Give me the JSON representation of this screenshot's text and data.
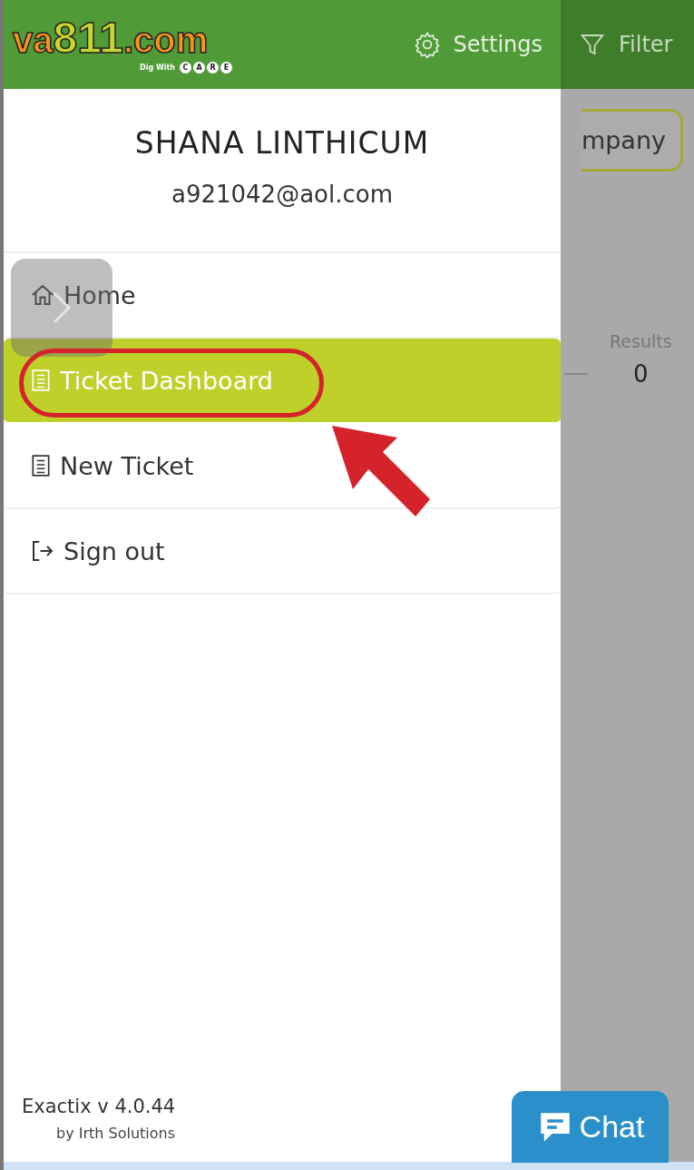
{
  "header": {
    "logo": {
      "parts": [
        "va",
        "811",
        ".com"
      ],
      "tagline": "Dig With",
      "care_letters": [
        "C",
        "A",
        "R",
        "E"
      ]
    },
    "settings_label": "Settings",
    "filter_label": "Filter"
  },
  "drawer": {
    "user_name": "SHANA LINTHICUM",
    "email": "a921042@aol.com",
    "menu": [
      {
        "label": "Home",
        "kind": "home",
        "selected": false
      },
      {
        "label": "Ticket Dashboard",
        "kind": "ticket",
        "selected": true
      },
      {
        "label": "New Ticket",
        "kind": "ticket",
        "selected": false
      },
      {
        "label": "Sign out",
        "kind": "signout",
        "selected": false
      }
    ],
    "version": "Exactix v 4.0.44",
    "vendor": "by Irth Solutions"
  },
  "background_page": {
    "company_button": "mpany",
    "results_label": "Results",
    "results_value": "0"
  },
  "chat_button": {
    "label": "Chat"
  }
}
